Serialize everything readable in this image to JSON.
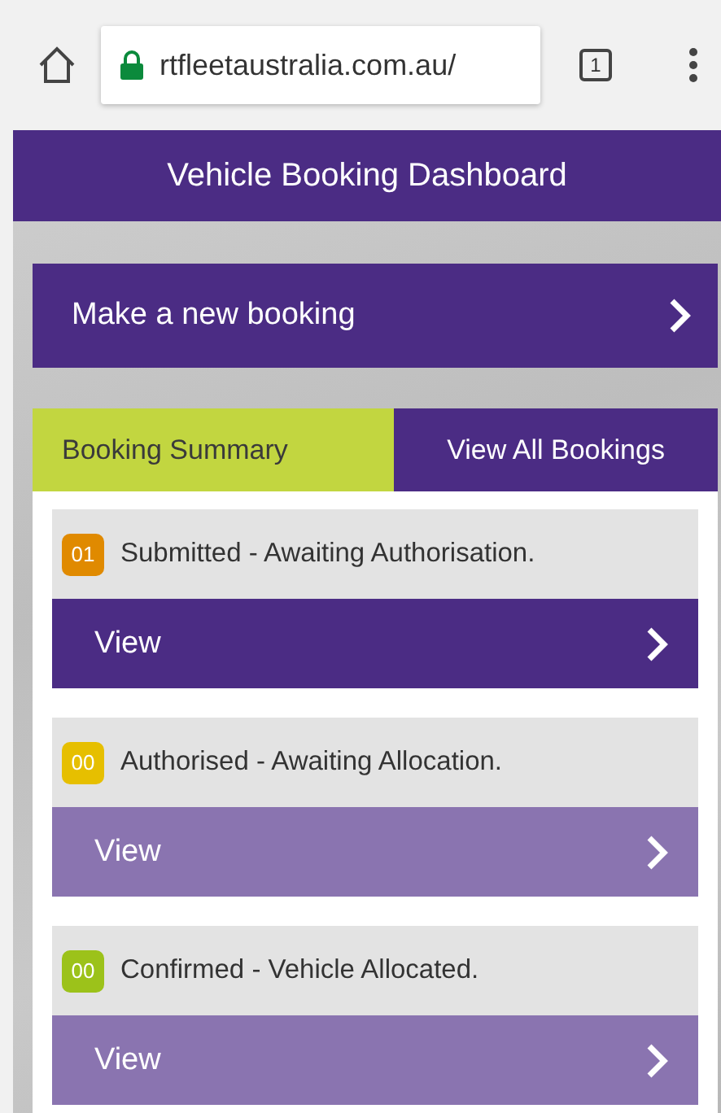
{
  "browser": {
    "url": "rtfleetaustralia.com.au/",
    "tab_count": "1"
  },
  "header": {
    "title": "Vehicle Booking Dashboard"
  },
  "new_booking": {
    "label": "Make a new booking"
  },
  "tabs": [
    {
      "label": "Booking Summary",
      "selected": true
    },
    {
      "label": "View All Bookings",
      "selected": false
    }
  ],
  "statuses": [
    {
      "count": "01",
      "label": "Submitted - Awaiting Authorisation.",
      "color": "#e08a00",
      "action": "View",
      "disabled": false
    },
    {
      "count": "00",
      "label": "Authorised - Awaiting Allocation.",
      "color": "#e6bf00",
      "action": "View",
      "disabled": true
    },
    {
      "count": "00",
      "label": "Confirmed - Vehicle Allocated.",
      "color": "#9cc21a",
      "action": "View",
      "disabled": true
    }
  ]
}
